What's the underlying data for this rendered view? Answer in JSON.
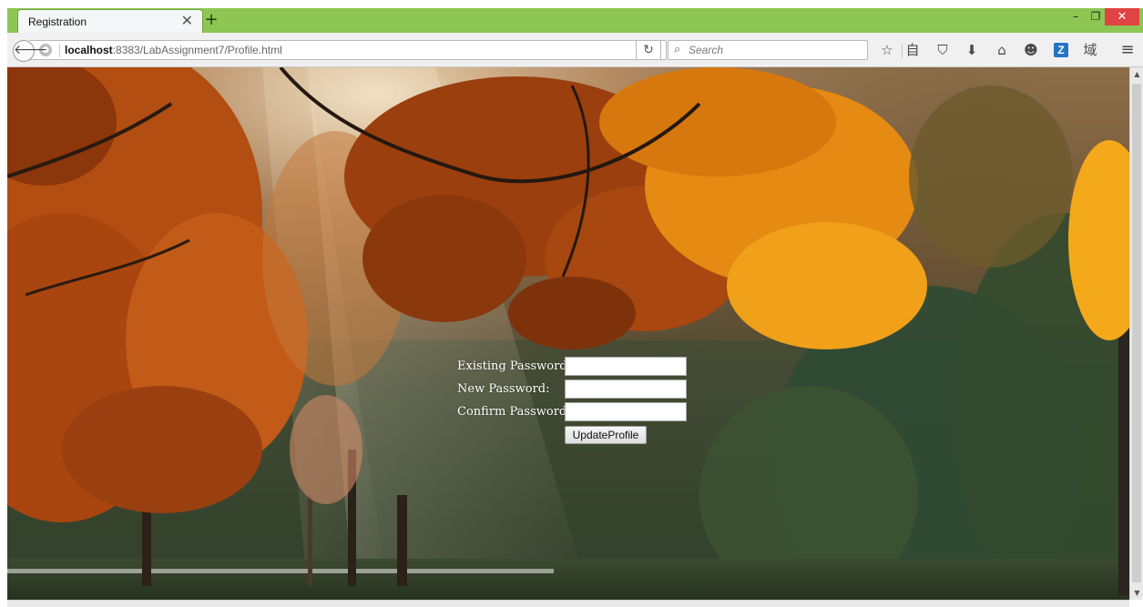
{
  "browser": {
    "tab": {
      "title": "Registration",
      "close_glyph": "✕"
    },
    "new_tab_glyph": "+",
    "window_controls": {
      "minimize": "–",
      "maximize": "❐",
      "close": "✕"
    },
    "nav": {
      "back_icon": "back-arrow-icon",
      "url_host": "localhost",
      "url_path": ":8383/LabAssignment7/Profile.html",
      "reload_glyph": "↻",
      "search_placeholder": "Search"
    },
    "toolbar_icons": [
      {
        "name": "bookmark-star-icon",
        "glyph": "☆"
      },
      {
        "name": "reading-list-icon",
        "glyph": "自"
      },
      {
        "name": "pocket-icon",
        "glyph": "⛉"
      },
      {
        "name": "download-icon",
        "glyph": "⬇"
      },
      {
        "name": "home-icon",
        "glyph": "⌂"
      },
      {
        "name": "chat-icon",
        "glyph": "☻"
      },
      {
        "name": "z-extension-icon",
        "glyph": "Z"
      },
      {
        "name": "domain-extension-icon",
        "glyph": "域"
      },
      {
        "name": "menu-icon",
        "glyph": "≡"
      }
    ]
  },
  "page": {
    "background": "autumn-forest-photo",
    "form": {
      "existing_password_label": "Existing Password:",
      "new_password_label": "New Password:",
      "confirm_password_label": "Confirm Password:",
      "existing_password_value": "",
      "new_password_value": "",
      "confirm_password_value": "",
      "submit_label": "UpdateProfile"
    }
  },
  "colors": {
    "titlebar": "#8dc653",
    "close_button": "#e04343",
    "label_text": "#ffffff"
  }
}
